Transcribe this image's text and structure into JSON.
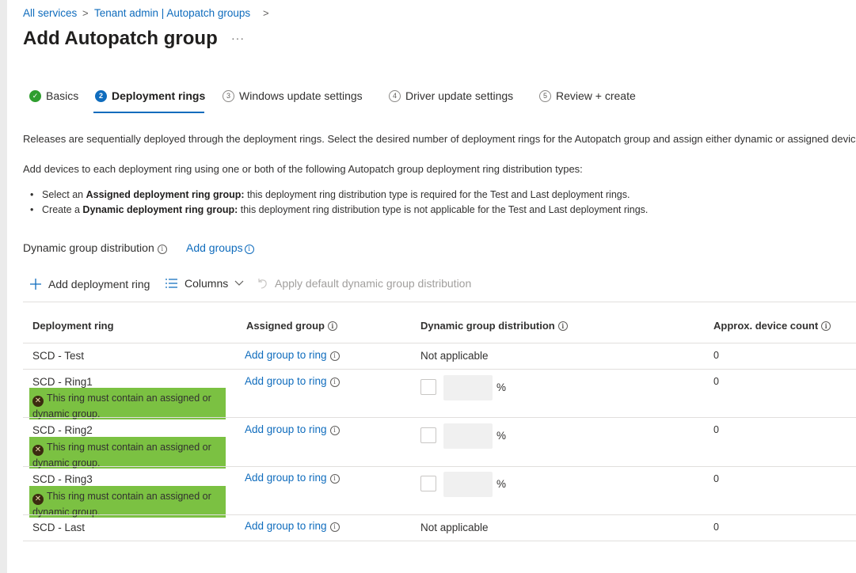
{
  "breadcrumb": {
    "items": [
      "All services",
      "Tenant admin | Autopatch groups"
    ],
    "sep": ">"
  },
  "page": {
    "title": "Add Autopatch group",
    "more": "···"
  },
  "tabs": [
    {
      "num": "✓",
      "label": "Basics",
      "state": "done"
    },
    {
      "num": "2",
      "label": "Deployment rings",
      "state": "active"
    },
    {
      "num": "3",
      "label": "Windows update settings",
      "state": "pending"
    },
    {
      "num": "4",
      "label": "Driver update settings",
      "state": "pending"
    },
    {
      "num": "5",
      "label": "Review + create",
      "state": "pending"
    }
  ],
  "content": {
    "intro": "Releases are sequentially deployed through the deployment rings. Select the desired number of deployment rings for the Autopatch group and assign either dynamic or assigned device",
    "add_devices": "Add devices to each deployment ring using one or both of the following Autopatch group deployment ring distribution types:",
    "bullets": [
      {
        "prefix": "Select an ",
        "bold": "Assigned deployment ring group:",
        "rest": " this deployment ring distribution type is required for the Test and Last deployment rings."
      },
      {
        "prefix": "Create a ",
        "bold": "Dynamic deployment ring group:",
        "rest": " this deployment ring distribution type is not applicable for the Test and Last deployment rings."
      }
    ],
    "dynamic_label": "Dynamic group distribution",
    "add_groups": "Add groups"
  },
  "toolbar": {
    "add_ring": "Add deployment ring",
    "columns": "Columns",
    "apply_default": "Apply default dynamic group distribution"
  },
  "table": {
    "headers": [
      "Deployment ring",
      "Assigned group",
      "Dynamic group distribution",
      "Approx. device count"
    ],
    "rows": [
      {
        "ring": "SCD - Test",
        "group": "Add group to ring",
        "dynamic": "Not applicable",
        "count": "0"
      },
      {
        "ring": "SCD - Ring1",
        "group": "Add group to ring",
        "dynamic": "",
        "pct": "%",
        "count": "0",
        "error": "This ring must contain an assigned or dynamic group."
      },
      {
        "ring": "SCD - Ring2",
        "group": "Add group to ring",
        "dynamic": "",
        "pct": "%",
        "count": "0",
        "error": "This ring must contain an assigned or dynamic group."
      },
      {
        "ring": "SCD - Ring3",
        "group": "Add group to ring",
        "dynamic": "",
        "pct": "%",
        "count": "0",
        "error": "This ring must contain an assigned or dynamic group."
      },
      {
        "ring": "SCD - Last",
        "group": "Add group to ring",
        "dynamic": "Not applicable",
        "count": "0"
      }
    ]
  },
  "colors": {
    "accent": "#0f6cbd",
    "success": "#2f9e2f",
    "highlight": "#7bc142"
  },
  "icons": {
    "info": "info-icon",
    "error": "error-icon",
    "add": "plus-icon",
    "columns": "columns-icon",
    "undo": "undo-icon",
    "check": "check-icon"
  }
}
